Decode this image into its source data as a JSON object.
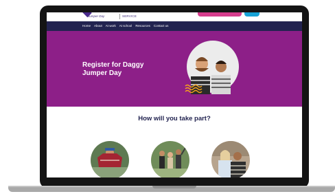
{
  "brand": {
    "logo_text": "Jumper Day",
    "logo_sub": "SERVICE"
  },
  "nav": {
    "items": [
      {
        "label": "Home"
      },
      {
        "label": "About"
      },
      {
        "label": "At work"
      },
      {
        "label": "At school"
      },
      {
        "label": "Resources"
      },
      {
        "label": "Contact us"
      }
    ]
  },
  "hero": {
    "title": "Register for Daggy Jumper Day"
  },
  "participation": {
    "heading": "How will you take part?"
  },
  "colors": {
    "nav_bg": "#222350",
    "hero_bg": "#8d1f88",
    "accent_pink": "#d63d8d",
    "accent_blue": "#17a2d6",
    "wave_orange": "#f5a31a"
  }
}
